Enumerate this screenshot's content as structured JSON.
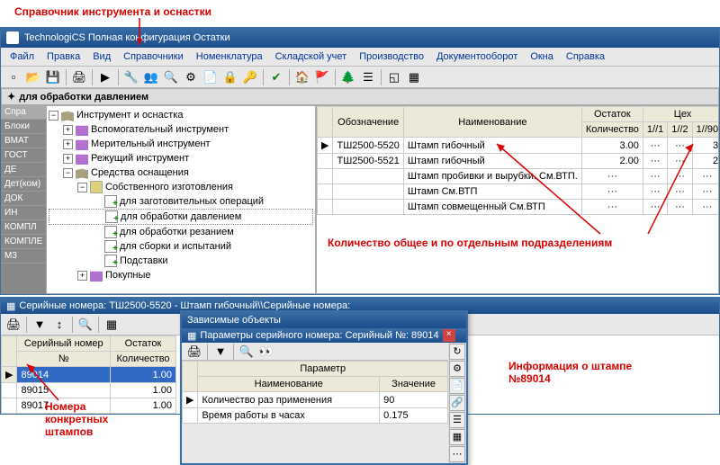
{
  "annotations": {
    "top": "Справочник инструмента и оснастки",
    "right": "Количество общее и по отдельным подразделениям",
    "bottom_left": "Номера\nконкретных\nштампов",
    "bottom_right": "Информация о штампе\n№89014"
  },
  "window_title": "TechnologiCS Полная конфигурация Остатки",
  "menu": [
    "Файл",
    "Правка",
    "Вид",
    "Справочники",
    "Номенклатура",
    "Складской учет",
    "Производство",
    "Документооборот",
    "Окна",
    "Справка"
  ],
  "section_label": "для обработки давлением",
  "sidebar_items": [
    "Спра",
    "Блоки",
    "ВМАТ",
    "ГОСТ",
    "ДЕ",
    "Дет(ком)",
    "ДОК",
    "ИН",
    "КОМПЛ",
    "КОМПЛЕ",
    "М3"
  ],
  "tree": {
    "root": "Инструмент и оснастка",
    "l1": [
      "Вспомогательный инструмент",
      "Мерительный инструмент",
      "Режущий инструмент",
      "Средства оснащения"
    ],
    "l2": [
      "Собственного изготовления",
      "Покупные"
    ],
    "l3": [
      "для заготовительных операций",
      "для обработки давлением",
      "для обработки резанием",
      "для сборки и испытаний",
      "Подставки"
    ]
  },
  "grid": {
    "headers": {
      "obz": "Обозначение",
      "naim": "Наименование",
      "ost": "Остаток",
      "kol": "Количество",
      "ceh": "Цех",
      "c1": "1//1",
      "c2": "1//2",
      "c3": "1//90"
    },
    "rows": [
      {
        "obz": "ТШ2500-5520",
        "naim": "Штамп гибочный",
        "kol": "3.00",
        "c1": "···",
        "c2": "···",
        "c3": "3"
      },
      {
        "obz": "ТШ2500-5521",
        "naim": "Штамп гибочный",
        "kol": "2.00",
        "c1": "···",
        "c2": "···",
        "c3": "2"
      },
      {
        "obz": "",
        "naim": "Штамп пробивки и вырубки. См.ВТП.",
        "kol": "···",
        "c1": "···",
        "c2": "···",
        "c3": "···"
      },
      {
        "obz": "",
        "naim": "Штамп См.ВТП",
        "kol": "···",
        "c1": "···",
        "c2": "···",
        "c3": "···"
      },
      {
        "obz": "",
        "naim": "Штамп совмещенный См.ВТП",
        "kol": "···",
        "c1": "···",
        "c2": "···",
        "c3": "···"
      }
    ]
  },
  "serial": {
    "title": "Серийные номера: ТШ2500-5520 - Штамп гибочный\\\\Серийные номера:",
    "col_sn": "Серийный номер",
    "col_no": "№",
    "col_ost": "Остаток",
    "col_kol": "Количество",
    "rows": [
      {
        "no": "89014",
        "kol": "1.00"
      },
      {
        "no": "89015",
        "kol": "1.00"
      },
      {
        "no": "89017",
        "kol": "1.00"
      }
    ]
  },
  "dep": {
    "win_title": "Зависимые объекты",
    "sub_title": "Параметры серийного номера: Серийный №:  89014",
    "col_param": "Параметр",
    "col_naim": "Наименование",
    "col_val": "Значение",
    "rows": [
      {
        "n": "Количество раз применения",
        "v": "90"
      },
      {
        "n": "Время работы в часах",
        "v": "0.175"
      }
    ]
  }
}
